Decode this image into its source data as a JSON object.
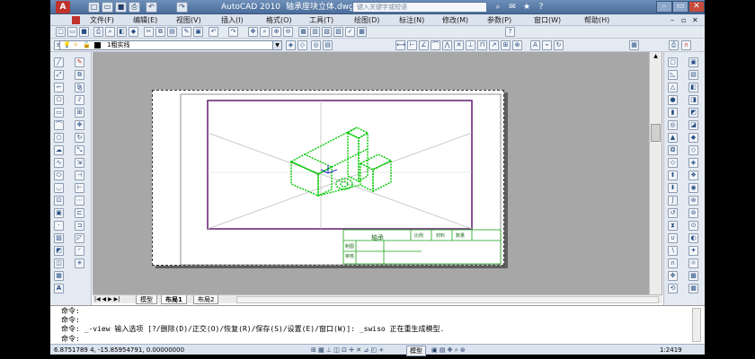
{
  "app": {
    "title": "AutoCAD 2010",
    "file": "轴承座块立体.dwg",
    "logo": "A"
  },
  "title_bar": {
    "search_placeholder": "键入关键字或短语"
  },
  "menus": [
    "文件(F)",
    "编辑(E)",
    "视图(V)",
    "插入(I)",
    "格式(O)",
    "工具(T)",
    "绘图(D)",
    "标注(N)",
    "修改(M)",
    "参数(P)",
    "窗口(W)",
    "帮助(H)"
  ],
  "layer": {
    "current": "1粗实线"
  },
  "tabs": [
    "模型",
    "布局1",
    "布局2"
  ],
  "title_block": {
    "name": "轴承",
    "col1": "比例",
    "col2": "材料",
    "col3": "数量",
    "row1": "制图",
    "row2": "审核"
  },
  "command": {
    "lines": [
      "命令:",
      "命令:",
      "命令: _-view 输入选项 [?/删除(D)/正交(O)/恢复(R)/保存(S)/设置(E)/窗口(W)]: _swiso 正在重生成模型.",
      "命令:"
    ]
  },
  "status": {
    "coords": "6.8751789 4, -15.85954791, 0.00000000",
    "model": "模型",
    "scale": "1:2419"
  },
  "colors": {
    "viewport_border": "#6b2a78",
    "model_wire": "#00c800",
    "title_block": "#1aa31a"
  }
}
